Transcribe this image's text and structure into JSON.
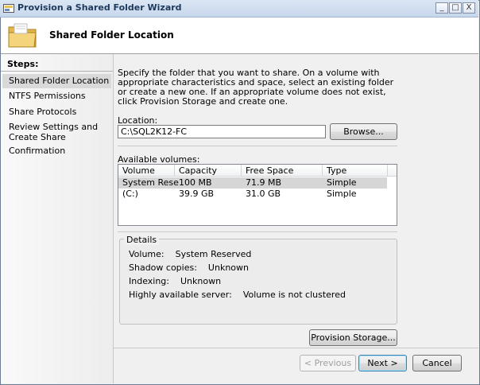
{
  "window": {
    "title": "Provision a Shared Folder Wizard",
    "controls": {
      "minimize": "_",
      "maximize": "□",
      "close": "X"
    }
  },
  "header": {
    "title": "Shared Folder Location"
  },
  "steps": {
    "title": "Steps:",
    "items": [
      {
        "label": "Shared Folder Location",
        "active": true
      },
      {
        "label": "NTFS Permissions",
        "active": false
      },
      {
        "label": "Share Protocols",
        "active": false
      },
      {
        "label": "Review Settings and Create Share",
        "active": false
      },
      {
        "label": "Confirmation",
        "active": false
      }
    ]
  },
  "main": {
    "description": "Specify the folder that you want to share. On a volume with appropriate characteristics and space, select an existing folder or create a new one. If an appropriate volume does not exist, click Provision Storage and create one.",
    "location_label": "Location:",
    "location_value": "C:\\SQL2K12-FC",
    "browse_label": "Browse...",
    "volumes_label": "Available volumes:",
    "volumes": {
      "columns": [
        "Volume",
        "Capacity",
        "Free Space",
        "Type"
      ],
      "rows": [
        {
          "volume": "System Reser...",
          "capacity": "100 MB",
          "free": "71.9 MB",
          "type": "Simple",
          "selected": true
        },
        {
          "volume": "(C:)",
          "capacity": "39.9 GB",
          "free": "31.0 GB",
          "type": "Simple",
          "selected": false
        }
      ]
    },
    "details": {
      "legend": "Details",
      "volume_label": "Volume:",
      "volume_value": "System Reserved",
      "shadow_label": "Shadow copies:",
      "shadow_value": "Unknown",
      "indexing_label": "Indexing:",
      "indexing_value": "Unknown",
      "ha_label": "Highly available server:",
      "ha_value": "Volume is not clustered"
    },
    "provision_label": "Provision Storage..."
  },
  "footer": {
    "previous_label": "< Previous",
    "next_label": "Next >",
    "cancel_label": "Cancel"
  },
  "colors": {
    "titlebar": "#c7d7ec",
    "selection": "#d6d6d6",
    "default_button_border": "#3c7fb1"
  }
}
